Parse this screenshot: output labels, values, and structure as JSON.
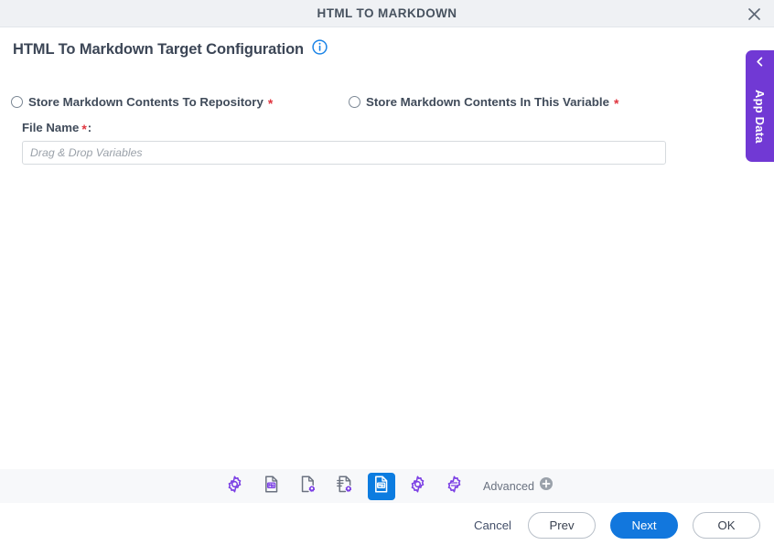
{
  "window": {
    "title": "HTML TO MARKDOWN",
    "close_icon": "close-icon"
  },
  "page": {
    "title": "HTML To Markdown Target Configuration",
    "info_icon": "info-icon"
  },
  "options": {
    "required_marker": "*",
    "radios": [
      {
        "label": "Store Markdown Contents To Repository",
        "required": "*",
        "selected": false
      },
      {
        "label": "Store Markdown Contents In This Variable",
        "required": "*",
        "selected": false
      }
    ]
  },
  "file_name_field": {
    "label": "File Name",
    "required": "*",
    "colon": ":",
    "value": "",
    "placeholder": "Drag & Drop Variables"
  },
  "app_data_tab": {
    "label": "App Data",
    "chevron_icon": "chevron-left-icon",
    "color": "#7139d4"
  },
  "toolbar": {
    "items": [
      {
        "icon": "gear-icon",
        "selected": false
      },
      {
        "icon": "markdown-document-icon",
        "selected": false
      },
      {
        "icon": "document-gear-icon",
        "selected": false
      },
      {
        "icon": "document-list-gear-icon",
        "selected": false
      },
      {
        "icon": "markdown-target-document-icon",
        "selected": true
      },
      {
        "icon": "gear-icon",
        "selected": false
      },
      {
        "icon": "gear-sliders-icon",
        "selected": false
      }
    ],
    "advanced_label": "Advanced",
    "advanced_icon": "plus-circle-icon",
    "selected_color": "#0c7ce0",
    "icon_color": "#7b3fe4"
  },
  "footer": {
    "cancel_label": "Cancel",
    "prev_label": "Prev",
    "next_label": "Next",
    "ok_label": "OK",
    "primary_color": "#1277dd"
  }
}
